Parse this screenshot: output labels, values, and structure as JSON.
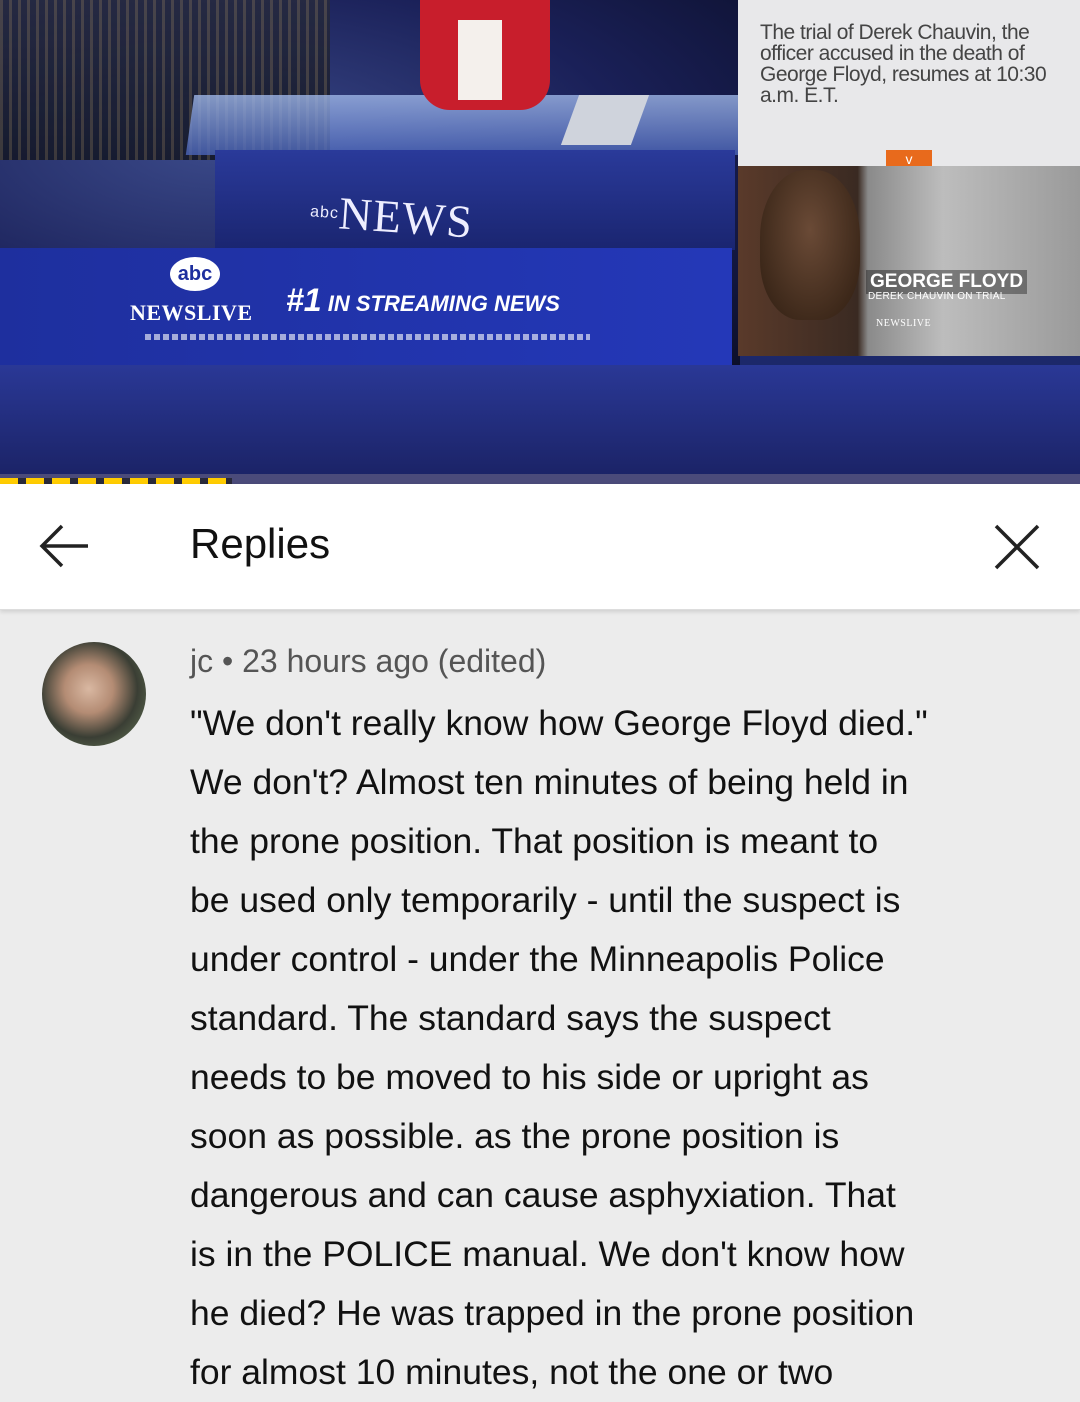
{
  "video": {
    "desk_logo": "NEWS",
    "desk_logo_prefix": "abc",
    "abc_badge": "abc",
    "newslive": "NEWSLIVE",
    "streaming_num": "#1",
    "streaming_text": "IN STREAMING NEWS",
    "side_text": "The trial of Derek Chauvin, the officer accused in the death of George Floyd, resumes at 10:30 a.m. E.T.",
    "chevron": "v",
    "gf_title": "GEORGE FLOYD",
    "gf_sub": "DEREK CHAUVIN ON TRIAL",
    "gf_live": "NEWSLIVE",
    "progress_fraction": 0.215,
    "colors": {
      "banner": "#2438b8",
      "progress": "#ffcc00",
      "chevron": "#e86a1c"
    }
  },
  "header": {
    "back_icon": "arrow-left-icon",
    "title": "Replies",
    "close_icon": "close-icon"
  },
  "comment": {
    "author": "jc",
    "separator": "•",
    "time": "23 hours ago (edited)",
    "lines": [
      "\"We don't really know how George Floyd died.\"",
      "We don't?  Almost ten minutes of being held in",
      "the prone position.  That position is meant to",
      "be used only temporarily -  until the suspect is",
      "under control - under the Minneapolis Police",
      "standard.  The standard says the suspect",
      "needs to be moved to his side or upright as",
      "soon as possible. as the prone position is",
      "dangerous and can cause asphyxiation. That",
      "is in the POLICE manual.  We don't know how",
      "he died? He was trapped in the prone position",
      "for almost 10 minutes, not the one or two"
    ]
  }
}
